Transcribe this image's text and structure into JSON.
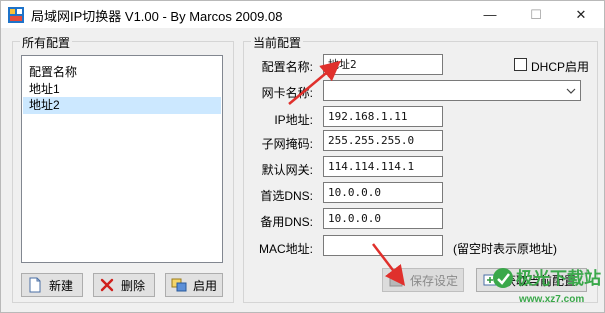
{
  "window": {
    "title": "局域网IP切换器 V1.00 - By Marcos 2009.08",
    "minimize_glyph": "—",
    "maximize_glyph": "☐",
    "close_glyph": "✕"
  },
  "configs": {
    "group_title": "所有配置",
    "list_header": "配置名称",
    "items": [
      "地址1",
      "地址2"
    ],
    "selected_index": 1,
    "buttons": {
      "new": "新建",
      "delete": "删除",
      "apply": "启用"
    }
  },
  "current": {
    "group_title": "当前配置",
    "config_name_label": "配置名称:",
    "config_name_value": "地址2",
    "dhcp_label": "DHCP启用",
    "dhcp_checked": false,
    "nic_label": "网卡名称:",
    "nic_value": "",
    "ip_label": "IP地址:",
    "ip_value": "192.168.1.11",
    "mask_label": "子网掩码:",
    "mask_value": "255.255.255.0",
    "gateway_label": "默认网关:",
    "gateway_value": "114.114.114.1",
    "dns1_label": "首选DNS:",
    "dns1_value": "10.0.0.0",
    "dns2_label": "备用DNS:",
    "dns2_value": "10.0.0.0",
    "mac_label": "MAC地址:",
    "mac_value": "",
    "mac_hint": "(留空时表示原地址)",
    "save_label": "保存设定",
    "fetch_label": "获取当前配置"
  },
  "watermark": {
    "text": "极光下载站",
    "url": "www.xz7.com"
  },
  "colors": {
    "accent_red": "#e0302c",
    "selection": "#cce8ff",
    "watermark_green": "#3aa84a"
  }
}
